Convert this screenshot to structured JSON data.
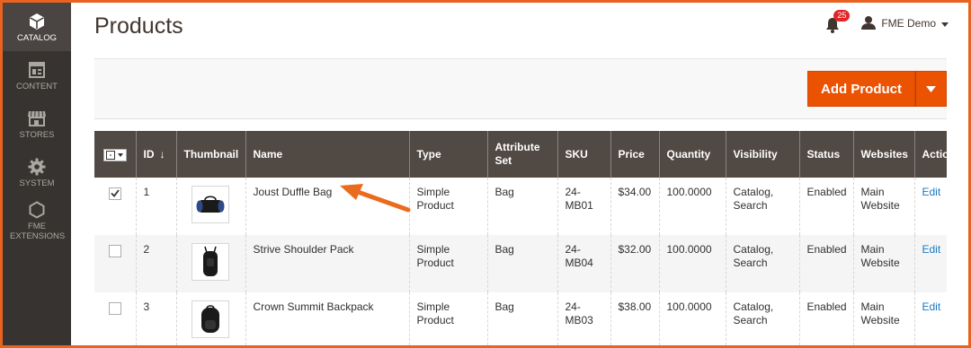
{
  "sidebar": {
    "items": [
      {
        "label": "CATALOG",
        "icon": "cube-icon",
        "active": true
      },
      {
        "label": "CONTENT",
        "icon": "layout-icon"
      },
      {
        "label": "STORES",
        "icon": "storefront-icon"
      },
      {
        "label": "SYSTEM",
        "icon": "gear-icon"
      },
      {
        "label": "FME EXTENSIONS",
        "icon": "hexagon-icon"
      }
    ]
  },
  "header": {
    "title": "Products",
    "notification_count": "25",
    "user_name": "FME Demo"
  },
  "actions": {
    "add_product_label": "Add Product"
  },
  "table": {
    "columns": [
      "ID",
      "Thumbnail",
      "Name",
      "Type",
      "Attribute Set",
      "SKU",
      "Price",
      "Quantity",
      "Visibility",
      "Status",
      "Websites",
      "Action"
    ],
    "sort_indicator": "↓",
    "rows": [
      {
        "checked": true,
        "id": "1",
        "name": "Joust Duffle Bag",
        "type": "Simple Product",
        "attribute_set": "Bag",
        "sku": "24-MB01",
        "price": "$34.00",
        "quantity": "100.0000",
        "visibility": "Catalog, Search",
        "status": "Enabled",
        "websites": "Main Website",
        "action": "Edit",
        "thumb": "duffle-bag-icon"
      },
      {
        "checked": false,
        "id": "2",
        "name": "Strive Shoulder Pack",
        "type": "Simple Product",
        "attribute_set": "Bag",
        "sku": "24-MB04",
        "price": "$32.00",
        "quantity": "100.0000",
        "visibility": "Catalog, Search",
        "status": "Enabled",
        "websites": "Main Website",
        "action": "Edit",
        "thumb": "shoulder-pack-icon"
      },
      {
        "checked": false,
        "id": "3",
        "name": "Crown Summit Backpack",
        "type": "Simple Product",
        "attribute_set": "Bag",
        "sku": "24-MB03",
        "price": "$38.00",
        "quantity": "100.0000",
        "visibility": "Catalog, Search",
        "status": "Enabled",
        "websites": "Main Website",
        "action": "Edit",
        "thumb": "backpack-icon"
      }
    ]
  },
  "colors": {
    "accent": "#eb5202",
    "sidebar": "#373330",
    "table_header": "#514943",
    "link": "#1979c3",
    "frame": "#e8631f"
  }
}
